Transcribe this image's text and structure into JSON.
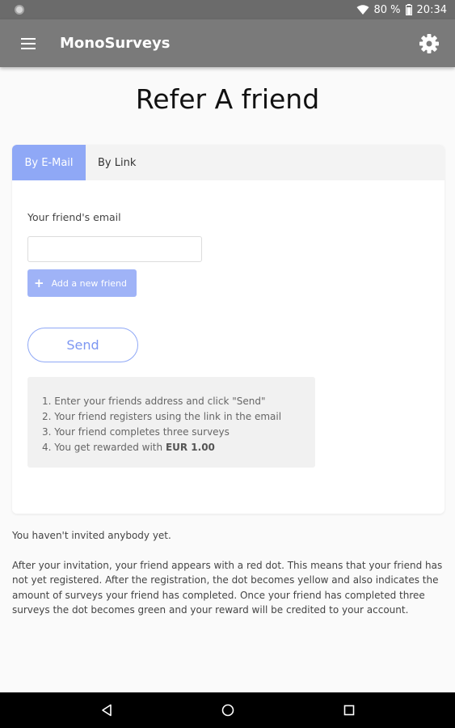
{
  "status_bar": {
    "battery": "80 %",
    "time": "20:34"
  },
  "app_bar": {
    "title": "MonoSurveys",
    "menu_icon": "menu-icon",
    "settings_icon": "gear-icon"
  },
  "page": {
    "title": "Refer A friend"
  },
  "tabs": [
    {
      "label": "By E-Mail",
      "active": true
    },
    {
      "label": "By Link",
      "active": false
    }
  ],
  "form": {
    "email_label": "Your friend's email",
    "email_value": "",
    "add_friend_label": "Add a new friend",
    "send_label": "Send"
  },
  "steps": {
    "line1": "1. Enter your friends address and click \"Send\"",
    "line2": "2. Your friend registers using the link in the email",
    "line3": "3. Your friend completes three surveys",
    "line4_prefix": "4. You get rewarded with ",
    "line4_reward": "EUR 1.00"
  },
  "footer": {
    "not_invited": "You haven't invited anybody yet.",
    "explanation": "After your invitation, your friend appears with a red dot. This means that your friend has not yet registered. After the registration, the dot becomes yellow and also indicates the amount of surveys your friend has completed. Once your friend has completed three surveys the dot becomes green and your reward will be credited to your account."
  },
  "colors": {
    "accent": "#8fa8f6",
    "app_bar": "#7a7a7a",
    "status_bar": "#6b6b6b"
  }
}
